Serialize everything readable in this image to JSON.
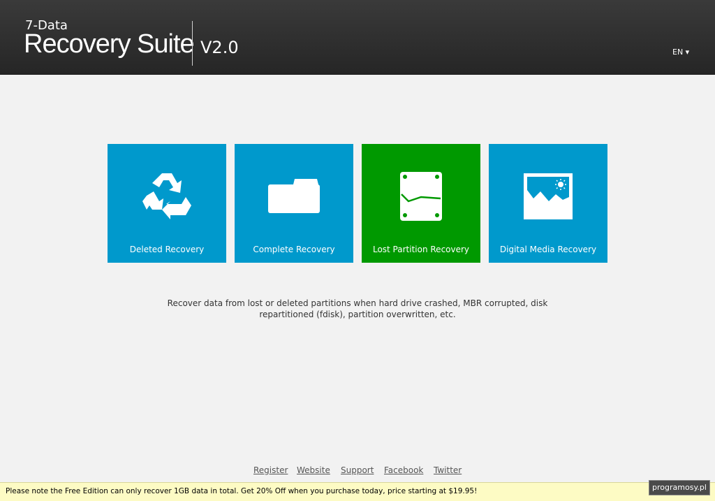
{
  "header": {
    "brand_top": "7-Data",
    "brand_main": "Recovery Suite",
    "version": "V2.0",
    "language": "EN ▾"
  },
  "tiles": [
    {
      "label": "Deleted Recovery",
      "icon": "recycle-icon",
      "color": "#0099cc"
    },
    {
      "label": "Complete Recovery",
      "icon": "folder-icon",
      "color": "#0099cc"
    },
    {
      "label": "Lost Partition Recovery",
      "icon": "partition-drive-icon",
      "color": "#009900"
    },
    {
      "label": "Digital Media Recovery",
      "icon": "picture-icon",
      "color": "#0099cc"
    }
  ],
  "description": {
    "line1": "Recover data from lost or deleted partitions when hard drive crashed, MBR corrupted, disk",
    "line2": "repartitioned (fdisk), partition overwritten, etc."
  },
  "footer_links": {
    "register": "Register",
    "website": "Website",
    "support": "Support",
    "facebook": "Facebook",
    "twitter": "Twitter"
  },
  "notice": {
    "text": "Please note the Free Edition can only recover 1GB data in total. Get 20% Off when you purchase today, price starting at $19.95!"
  },
  "watermark": "programosy.pl"
}
